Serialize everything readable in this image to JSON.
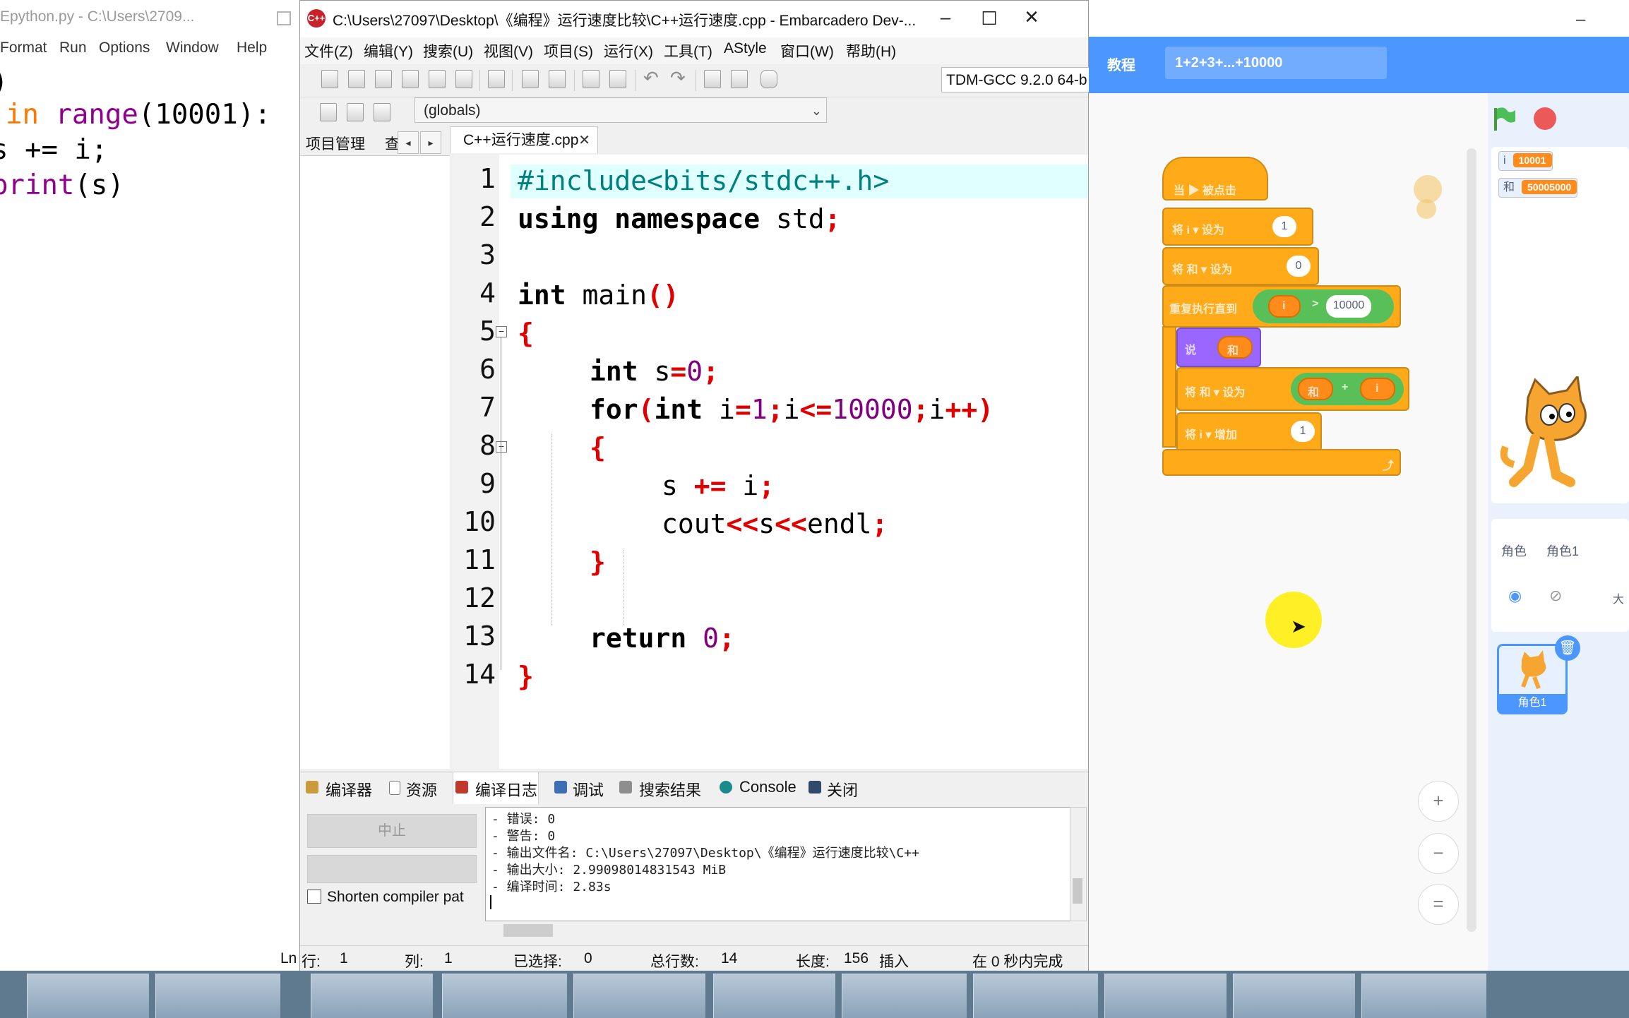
{
  "python": {
    "title": "Epython.py - C:\\Users\\2709...",
    "menu": [
      "Format",
      "Run",
      "Options",
      "Window",
      "Help"
    ],
    "lines": [
      ")",
      "in",
      "range",
      "(10001):",
      "s += i;",
      "print",
      "(s)"
    ]
  },
  "devcpp": {
    "title": "C:\\Users\\27097\\Desktop\\《编程》运行速度比较\\C++运行速度.cpp - Embarcadero Dev-...",
    "menu": [
      "文件(Z)",
      "编辑(Y)",
      "搜索(U)",
      "视图(V)",
      "项目(S)",
      "运行(X)",
      "工具(T)",
      "AStyle",
      "窗口(W)",
      "帮助(H)"
    ],
    "compiler": "TDM-GCC 9.2.0 64-b",
    "globals": "(globals)",
    "left_tabs": [
      "项目管理",
      "查"
    ],
    "file_tab": "C++运行速度.cpp",
    "line_numbers": [
      "1",
      "2",
      "3",
      "4",
      "5",
      "6",
      "7",
      "8",
      "9",
      "10",
      "11",
      "12",
      "13",
      "14"
    ],
    "code": {
      "l1": "#include<bits/stdc++.h>",
      "l2_kw": "using namespace",
      "l2_rest": " std",
      "l2_sym": ";",
      "l4_kw": "int",
      "l4_rest": " main",
      "l4_sym": "()",
      "l5": "{",
      "l6_kw": "int",
      "l6_a": " s",
      "l6_eq": "=",
      "l6_num": "0",
      "l6_sc": ";",
      "l7_kw": "for",
      "l7_p": "(",
      "l7_kw2": "int",
      "l7_a": " i",
      "l7_eq": "=",
      "l7_n1": "1",
      "l7_sc1": ";",
      "l7_b": "i",
      "l7_le": "<=",
      "l7_n2": "10000",
      "l7_sc2": ";",
      "l7_c": "i",
      "l7_pp": "++",
      "l7_cp": ")",
      "l8": "{",
      "l9_a": "s ",
      "l9_op": "+=",
      "l9_b": " i",
      "l9_sc": ";",
      "l10_a": "cout",
      "l10_op1": "<<",
      "l10_b": "s",
      "l10_op2": "<<",
      "l10_c": "endl",
      "l10_sc": ";",
      "l11": "}",
      "l13_kw": "return",
      "l13_num": " 0",
      "l13_sc": ";",
      "l14": "}"
    },
    "bottom_tabs": [
      "编译器",
      "资源",
      "编译日志",
      "调试",
      "搜索结果",
      "Console",
      "关闭"
    ],
    "abort_label": "中止",
    "shorten_label": "Shorten compiler pat",
    "log": [
      "- 错误: 0",
      "- 警告: 0",
      "- 输出文件名: C:\\Users\\27097\\Desktop\\《编程》运行速度比较\\C++",
      "- 输出大小: 2.99098014831543 MiB",
      "- 编译时间: 2.83s"
    ],
    "status": {
      "ln_prefix": "Ln",
      "row_label": "行:",
      "row": "1",
      "col_label": "列:",
      "col": "1",
      "sel_label": "已选择:",
      "sel": "0",
      "lines_label": "总行数:",
      "lines": "14",
      "len_label": "长度:",
      "len": "156",
      "mode": "插入",
      "done": "在 0 秒内完成"
    }
  },
  "scratch": {
    "tutorial": "教程",
    "project_title": "1+2+3+...+10000",
    "monitors": [
      {
        "name": "i",
        "value": "10001"
      },
      {
        "name": "和",
        "value": "50005000"
      }
    ],
    "blocks": {
      "hat": "当 ▶ 被点击",
      "set_i": "将 i ▾ 设为",
      "set_i_val": "1",
      "set_sum": "将 和 ▾ 设为",
      "set_sum_val": "0",
      "repeat": "重复执行直到",
      "cond_var": "i",
      "cond_op": ">",
      "cond_val": "10000",
      "say": "说",
      "say_val": "和",
      "set_sum2": "将 和 ▾ 设为",
      "add_a": "和",
      "add_op": "+",
      "add_b": "i",
      "change_i": "将 i ▾ 增加",
      "change_val": "1"
    },
    "sprite_label": "角色",
    "sprite_name": "角色1",
    "sprite_thumb": "角色1",
    "size_label": "大"
  }
}
